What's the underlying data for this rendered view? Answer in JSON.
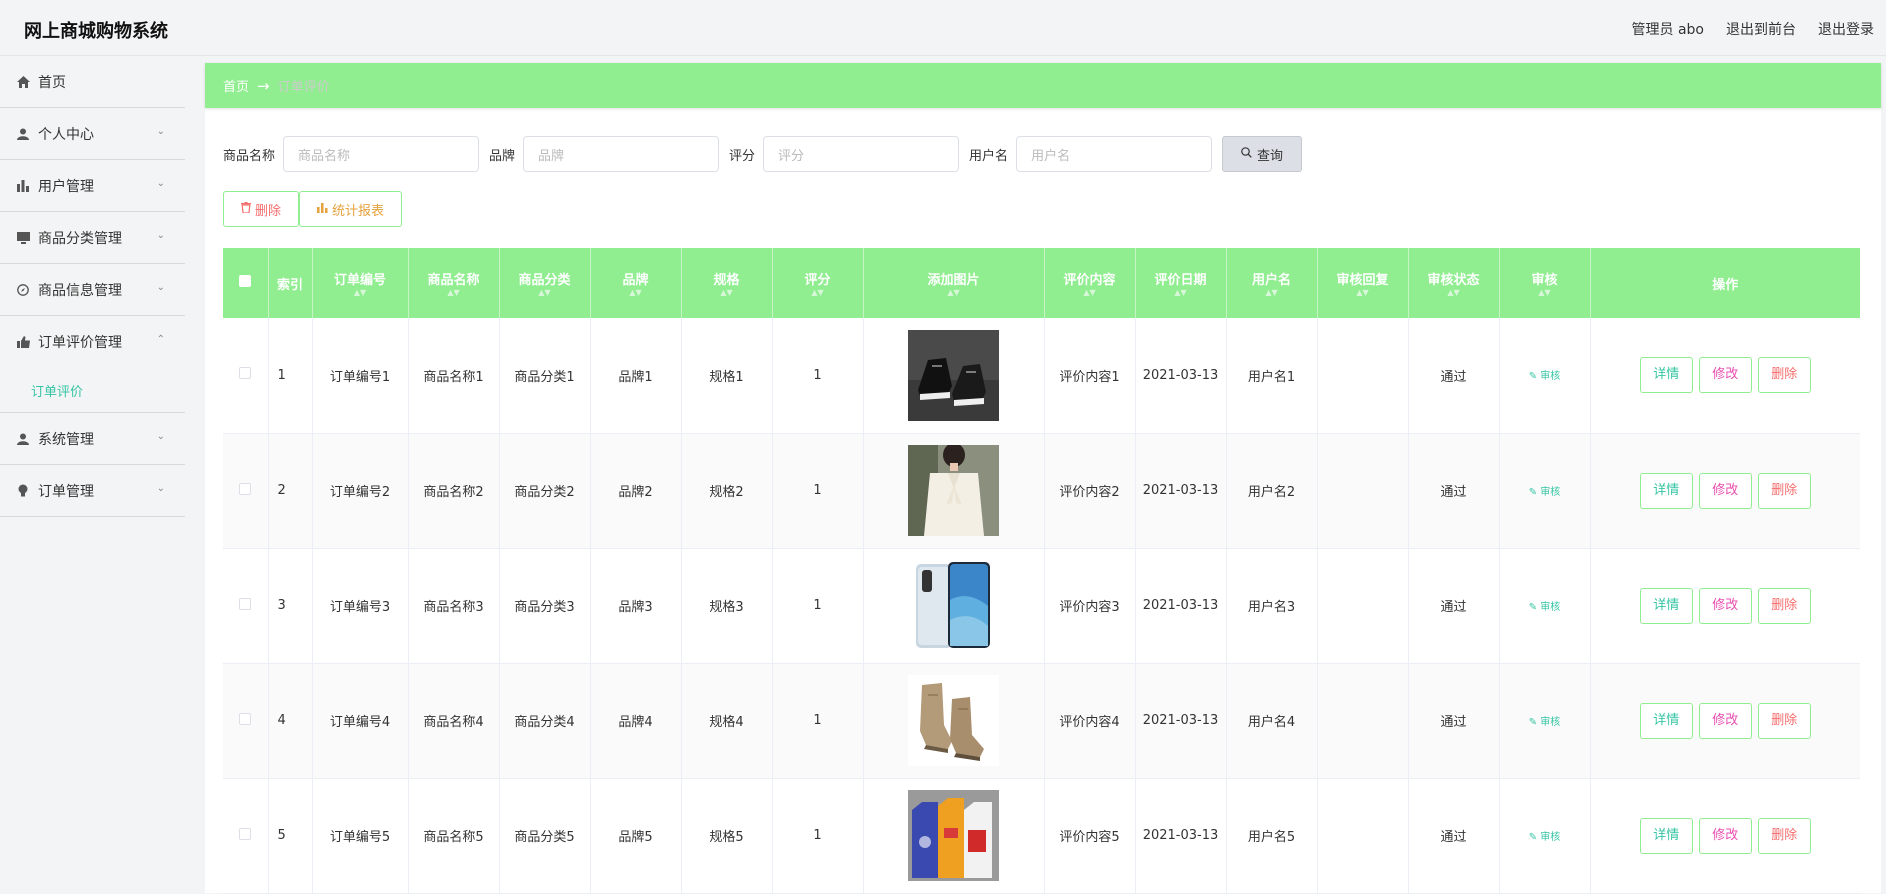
{
  "header": {
    "brand": "网上商城购物系统",
    "admin": "管理员 abo",
    "to_front": "退出到前台",
    "logout": "退出登录"
  },
  "sidebar": {
    "items": [
      {
        "label": "首页",
        "icon": "home-icon"
      },
      {
        "label": "个人中心",
        "icon": "user-icon"
      },
      {
        "label": "用户管理",
        "icon": "bar-chart-icon"
      },
      {
        "label": "商品分类管理",
        "icon": "monitor-icon"
      },
      {
        "label": "商品信息管理",
        "icon": "compass-icon"
      },
      {
        "label": "订单评价管理",
        "icon": "thumb-icon"
      },
      {
        "label": "系统管理",
        "icon": "user-icon"
      },
      {
        "label": "订单管理",
        "icon": "bulb-icon"
      }
    ],
    "submenu_active": "订单评价"
  },
  "breadcrumb": {
    "home": "首页",
    "arrow": "→",
    "current": "订单评价"
  },
  "search": {
    "product_name_label": "商品名称",
    "product_name_placeholder": "商品名称",
    "brand_label": "品牌",
    "brand_placeholder": "品牌",
    "rating_label": "评分",
    "rating_placeholder": "评分",
    "username_label": "用户名",
    "username_placeholder": "用户名",
    "query_label": "查询"
  },
  "actions": {
    "delete_label": "删除",
    "stats_label": "统计报表"
  },
  "table": {
    "headers": [
      "索引",
      "订单编号",
      "商品名称",
      "商品分类",
      "品牌",
      "规格",
      "评分",
      "添加图片",
      "评价内容",
      "评价日期",
      "用户名",
      "审核回复",
      "审核状态",
      "审核",
      "操作"
    ],
    "rows": [
      {
        "index": "1",
        "order_no": "订单编号1",
        "name": "商品名称1",
        "category": "商品分类1",
        "brand": "品牌1",
        "spec": "规格1",
        "rating": "1",
        "content": "评价内容1",
        "date": "2021-03-13",
        "user": "用户名1",
        "reply": "",
        "status": "通过",
        "image": "sneaker"
      },
      {
        "index": "2",
        "order_no": "订单编号2",
        "name": "商品名称2",
        "category": "商品分类2",
        "brand": "品牌2",
        "spec": "规格2",
        "rating": "1",
        "content": "评价内容2",
        "date": "2021-03-13",
        "user": "用户名2",
        "reply": "",
        "status": "通过",
        "image": "blouse"
      },
      {
        "index": "3",
        "order_no": "订单编号3",
        "name": "商品名称3",
        "category": "商品分类3",
        "brand": "品牌3",
        "spec": "规格3",
        "rating": "1",
        "content": "评价内容3",
        "date": "2021-03-13",
        "user": "用户名3",
        "reply": "",
        "status": "通过",
        "image": "phone"
      },
      {
        "index": "4",
        "order_no": "订单编号4",
        "name": "商品名称4",
        "category": "商品分类4",
        "brand": "品牌4",
        "spec": "规格4",
        "rating": "1",
        "content": "评价内容4",
        "date": "2021-03-13",
        "user": "用户名4",
        "reply": "",
        "status": "通过",
        "image": "boots"
      },
      {
        "index": "5",
        "order_no": "订单编号5",
        "name": "商品名称5",
        "category": "商品分类5",
        "brand": "品牌5",
        "spec": "规格5",
        "rating": "1",
        "content": "评价内容5",
        "date": "2021-03-13",
        "user": "用户名5",
        "reply": "",
        "status": "通过",
        "image": "boxes"
      }
    ],
    "audit_label": "审核",
    "detail_label": "详情",
    "edit_label": "修改",
    "delete_label": "删除"
  }
}
